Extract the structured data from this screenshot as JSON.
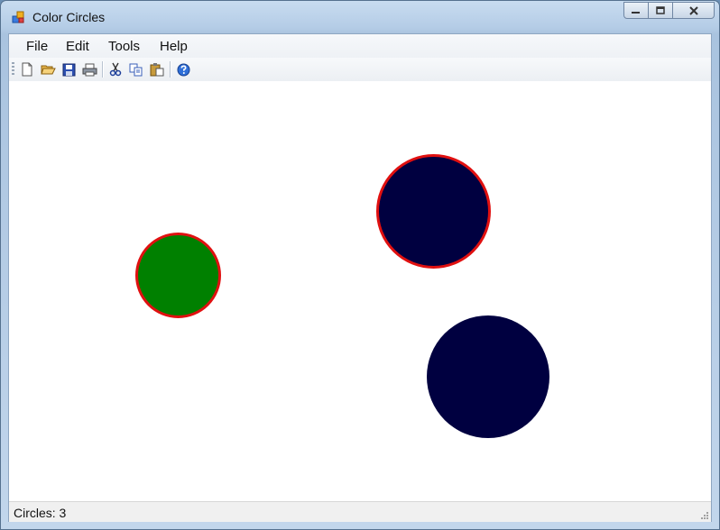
{
  "window": {
    "title": "Color Circles"
  },
  "menu": {
    "items": [
      "File",
      "Edit",
      "Tools",
      "Help"
    ]
  },
  "toolbar": {
    "buttons": [
      "new-icon",
      "open-icon",
      "save-icon",
      "print-icon",
      "cut-icon",
      "copy-icon",
      "paste-icon",
      "help-icon"
    ]
  },
  "canvas": {
    "circles": [
      {
        "fill": "#008000",
        "border": "#e01010"
      },
      {
        "fill": "#000040",
        "border": "#e01010"
      },
      {
        "fill": "#000040",
        "border": "none"
      }
    ]
  },
  "status": {
    "text": "Circles: 3"
  }
}
